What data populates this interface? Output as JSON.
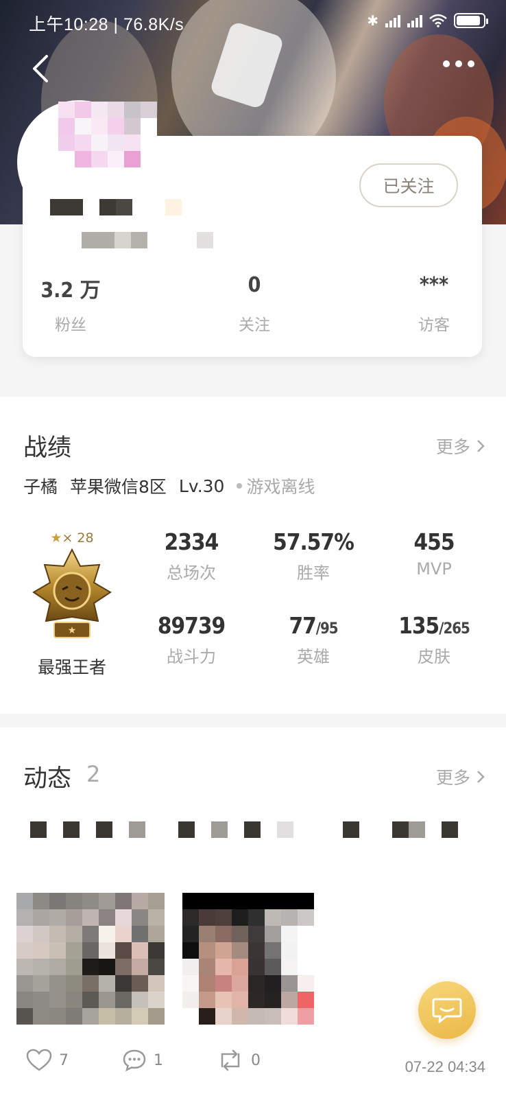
{
  "status_bar": {
    "time": "上午10:28",
    "speed": "76.8K/s",
    "icons": [
      "bluetooth-icon",
      "signal-icon",
      "signal-icon",
      "wifi-icon",
      "battery-icon"
    ]
  },
  "header": {
    "back_icon": "back-arrow-icon",
    "more_icon": "more-dots-icon"
  },
  "profile": {
    "follow_button": "已关注",
    "stats": [
      {
        "value": "3.2 万",
        "label": "粉丝"
      },
      {
        "value": "0",
        "label": "关注"
      },
      {
        "value": "***",
        "label": "访客"
      }
    ]
  },
  "record": {
    "title": "战绩",
    "more": "更多",
    "role_name": "子橘",
    "server": "苹果微信8区",
    "level": "Lv.30",
    "status": "游戏离线",
    "rank": {
      "stars_label": "× 28",
      "name": "最强王者"
    },
    "stats": [
      {
        "value": "2334",
        "label": "总场次"
      },
      {
        "value": "57.57%",
        "label": "胜率"
      },
      {
        "value": "455",
        "label": "MVP"
      },
      {
        "value": "89739",
        "label": "战斗力"
      },
      {
        "value": "77",
        "sub": "/95",
        "label": "英雄"
      },
      {
        "value": "135",
        "sub": "/265",
        "label": "皮肤"
      }
    ]
  },
  "feed": {
    "title": "动态",
    "count": "2",
    "more": "更多",
    "likes": "7",
    "comments": "1",
    "reposts": "0",
    "timestamp": "07-22 04:34"
  },
  "colors": {
    "accent": "#eab847",
    "muted": "#aaaaaa",
    "text": "#333333"
  }
}
